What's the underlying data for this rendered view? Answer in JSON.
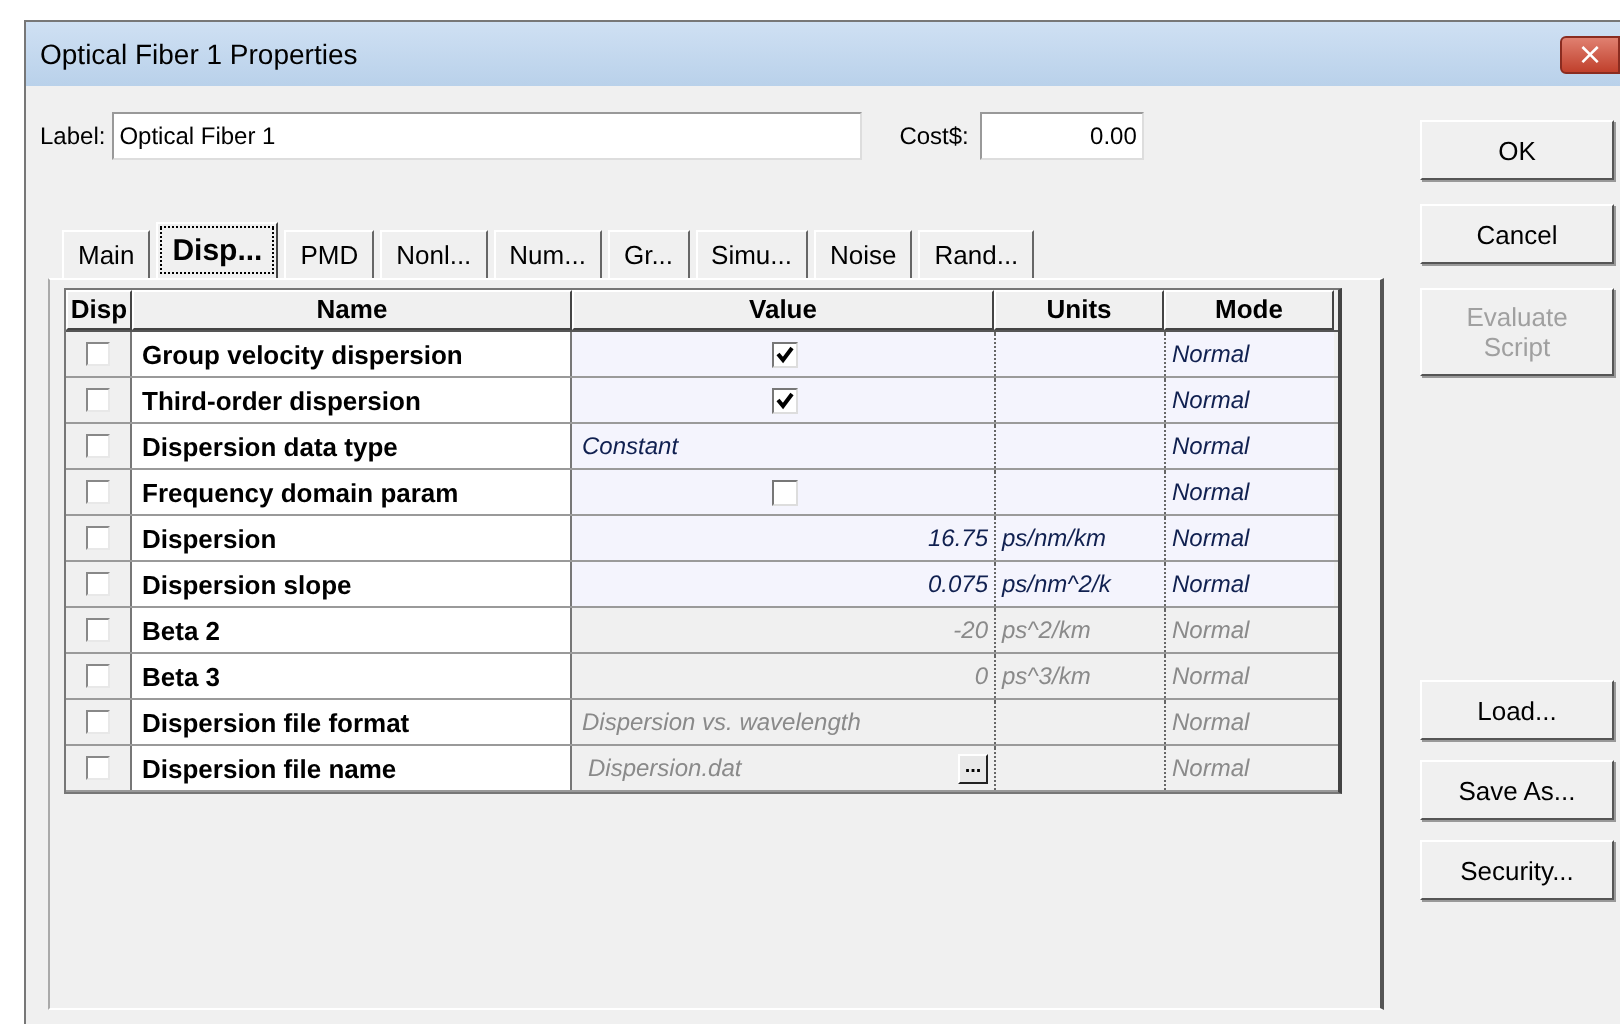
{
  "window": {
    "title": "Optical Fiber 1 Properties",
    "close": "×"
  },
  "label_field": {
    "label": "Label:",
    "value": "Optical Fiber 1"
  },
  "cost_field": {
    "label": "Cost$:",
    "value": "0.00"
  },
  "tabs": [
    {
      "label": "Main",
      "selected": false
    },
    {
      "label": "Disp...",
      "selected": true
    },
    {
      "label": "PMD",
      "selected": false
    },
    {
      "label": "Nonl...",
      "selected": false
    },
    {
      "label": "Num...",
      "selected": false
    },
    {
      "label": "Gr...",
      "selected": false
    },
    {
      "label": "Simu...",
      "selected": false
    },
    {
      "label": "Noise",
      "selected": false
    },
    {
      "label": "Rand...",
      "selected": false
    }
  ],
  "table": {
    "columns": [
      "Disp",
      "Name",
      "Value",
      "Units",
      "Mode"
    ],
    "rows": [
      {
        "disp": false,
        "name": "Group velocity dispersion",
        "kind": "check",
        "checked": true,
        "mode": "Normal",
        "disabled": false
      },
      {
        "disp": false,
        "name": "Third-order dispersion",
        "kind": "check",
        "checked": true,
        "mode": "Normal",
        "disabled": false
      },
      {
        "disp": false,
        "name": "Dispersion data type",
        "kind": "text",
        "value": "Constant",
        "mode": "Normal",
        "disabled": false
      },
      {
        "disp": false,
        "name": "Frequency domain param",
        "kind": "check",
        "checked": false,
        "mode": "Normal",
        "disabled": false
      },
      {
        "disp": false,
        "name": "Dispersion",
        "kind": "number",
        "value": "16.75",
        "units": "ps/nm/km",
        "mode": "Normal",
        "disabled": false
      },
      {
        "disp": false,
        "name": "Dispersion slope",
        "kind": "number",
        "value": "0.075",
        "units": "ps/nm^2/k",
        "mode": "Normal",
        "disabled": false
      },
      {
        "disp": false,
        "name": "Beta 2",
        "kind": "number",
        "value": "-20",
        "units": "ps^2/km",
        "mode": "Normal",
        "disabled": true
      },
      {
        "disp": false,
        "name": "Beta 3",
        "kind": "number",
        "value": "0",
        "units": "ps^3/km",
        "mode": "Normal",
        "disabled": true
      },
      {
        "disp": false,
        "name": "Dispersion file format",
        "kind": "text",
        "value": "Dispersion vs. wavelength",
        "mode": "Normal",
        "disabled": true
      },
      {
        "disp": false,
        "name": "Dispersion file name",
        "kind": "file",
        "value": "Dispersion.dat",
        "browse": "...",
        "mode": "Normal",
        "disabled": true
      }
    ]
  },
  "buttons": [
    {
      "label": "OK",
      "disabled": false
    },
    {
      "label": "Cancel",
      "disabled": false
    },
    {
      "label": "Evaluate Script",
      "disabled": true
    }
  ],
  "file_buttons": [
    {
      "label": "Load...",
      "disabled": false
    },
    {
      "label": "Save As...",
      "disabled": false
    },
    {
      "label": "Security...",
      "disabled": false
    }
  ]
}
